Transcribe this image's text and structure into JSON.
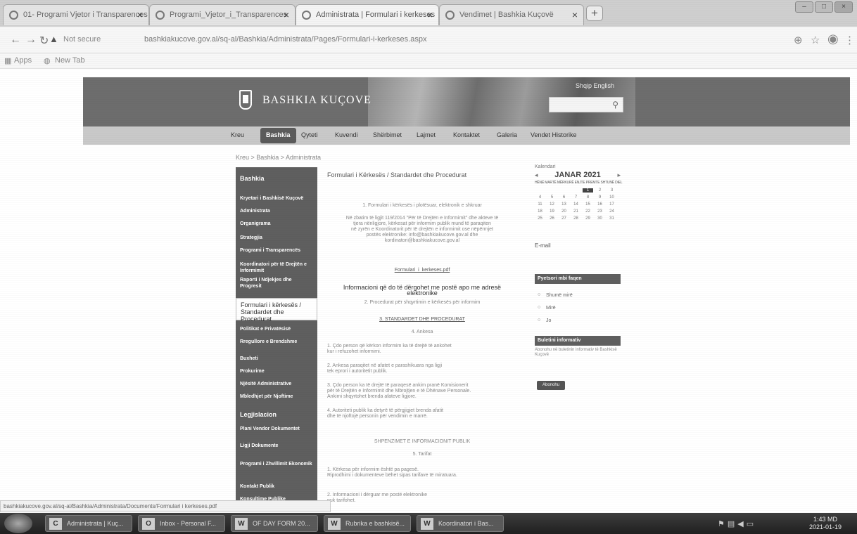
{
  "browser": {
    "tabs": [
      {
        "label": "01- Programi Vjetor i Transparences"
      },
      {
        "label": "Programi_Vjetor_i_Transparences"
      },
      {
        "label": "Administrata | Formulari i kerkeses"
      },
      {
        "label": "Vendimet | Bashkia Kuçovë"
      }
    ],
    "url_warning": "Not secure",
    "url": "bashkiakucove.gov.al/sq-al/Bashkia/Administrata/Pages/Formulari-i-kerkeses.aspx",
    "bookmarks": [
      {
        "label": "Apps"
      },
      {
        "label": "New Tab"
      }
    ],
    "status_url": "bashkiakucove.gov.al/sq-al/Bashkia/Administrata/Documents/Formulari i kerkeses.pdf"
  },
  "site": {
    "name": "BASHKIA KUÇOVE",
    "lang_link": "Shqip  English",
    "search_placeholder": ""
  },
  "mainnav": [
    "Kreu",
    "Bashkia",
    "Qyteti",
    "Kuvendi",
    "Shërbimet",
    "Lajmet",
    "Kontaktet",
    "Galeria",
    "Vendet Historike"
  ],
  "breadcrumb": "Kreu > Bashkia > Administrata",
  "sidebar": [
    "Bashkia",
    "Kryetari i Bashkisë Kuçovë",
    "Administrata",
    "Organigrama",
    "Strategjia",
    "Programi i Transparencës",
    "Koordinatori për të Drejtën e Informimit",
    "Raporti i Ndjekjes dhe Progresit",
    "Formulari i kërkesës / Standardet dhe Procedurat",
    "Politikat e Privatësisë",
    "Rregullore e Brendshme",
    "Buxheti",
    "Prokurime",
    "Njësitë Administrative",
    "Mbledhjet për Njoftime",
    "Legjislacion",
    "Plani Vendor Dokumentet",
    "Ligji Dokumente",
    "Programi i Zhvillimit Ekonomik",
    "Kontakt Publik",
    "Konsultime Publike"
  ],
  "content": {
    "title": "Formulari i Kërkesës / Standardet dhe Procedurat",
    "p1": "1. Formulari i kërkesës i plotësuar, elektronik e shkruar",
    "p2": [
      "Në zbatim të ligjit 119/2014 \"Për të Drejtën e Informimit\" dhe akteve të",
      "tjera nënligjore, kërkesat për informim publik mund të paraqiten",
      "në zyrën e Koordinatorit për të drejtën e informimit ose nëpërmjet",
      "postës elektronike: info@bashkiakucove.gov.al dhe",
      "kordinatori@bashkiakucove.gov.al"
    ],
    "link": "Formulari_i_kerkeses.pdf",
    "bold": "Informacioni që do të dërgohet me postë apo me adresë elektronike",
    "p3": "2. Procedurat për shqyrtimin e kërkesës për informim",
    "p4": "3. STANDARDET DHE PROCEDURAT",
    "p5": "4. Ankesa",
    "p6": [
      "1. Çdo person që kërkon informim ka të drejtë të ankohet",
      "kur i refuzohet informimi."
    ],
    "p7": [
      "2. Ankesa paraqitet në afatet e parashikuara nga ligji",
      "tek eprori i autoritetit publik."
    ],
    "p8": [
      "3. Çdo person ka të drejtë të paraqesë ankim pranë Komisionerit",
      "për të Drejtën e Informimit dhe Mbrojtjen e të Dhënave Personale.",
      "Ankimi shqyrtohet brenda afateve ligjore."
    ],
    "p9": [
      "4. Autoriteti publik ka detyrë të përgjigjet brenda afatit",
      "dhe të njoftojë personin për vendimin e marrë."
    ],
    "p10": "SHPENZIMET E INFORMACIONIT PUBLIK",
    "p11": "5. Tarifat",
    "p12": [
      "1. Kërkesa për informim është pa pagesë.",
      "Riprodhimi i dokumenteve bëhet sipas tarifave të miratuara."
    ],
    "p13": [
      "2. Informacioni i dërguar me postë elektronike",
      "nuk tarifohet."
    ]
  },
  "calendar": {
    "label": "Kalendari",
    "month": "JANAR 2021",
    "day_header": "HËNË MARTË MËRKURË ENJTE PREMTE SHTUNË DIEL",
    "weeks": [
      [
        "",
        "",
        "",
        "",
        "1",
        "2",
        "3"
      ],
      [
        "4",
        "5",
        "6",
        "7",
        "8",
        "9",
        "10"
      ],
      [
        "11",
        "12",
        "13",
        "14",
        "15",
        "16",
        "17"
      ],
      [
        "18",
        "19",
        "20",
        "21",
        "22",
        "23",
        "24"
      ],
      [
        "25",
        "26",
        "27",
        "28",
        "29",
        "30",
        "31"
      ]
    ],
    "today": "1"
  },
  "mail_text": "E-mail",
  "poll": {
    "title": "Pyetsori mbi faqen",
    "options": [
      "Shumë mirë",
      "Mirë",
      "Jo"
    ]
  },
  "newsletter": {
    "title": "Buletini informativ",
    "desc": "Abonohu në buletinin informativ të Bashkisë Kuçovë",
    "button": "Abonohu"
  },
  "taskbar": {
    "items": [
      {
        "label": "Administrata | Kuç...",
        "icon": "C"
      },
      {
        "label": "Inbox - Personal F...",
        "icon": "O"
      },
      {
        "label": "OF DAY FORM 20...",
        "icon": "W"
      },
      {
        "label": "Rubrika e bashkisë...",
        "icon": "W"
      },
      {
        "label": "Koordinatori i Bas...",
        "icon": "W"
      }
    ],
    "time": "1:43 MD",
    "date": "2021-01-19"
  }
}
